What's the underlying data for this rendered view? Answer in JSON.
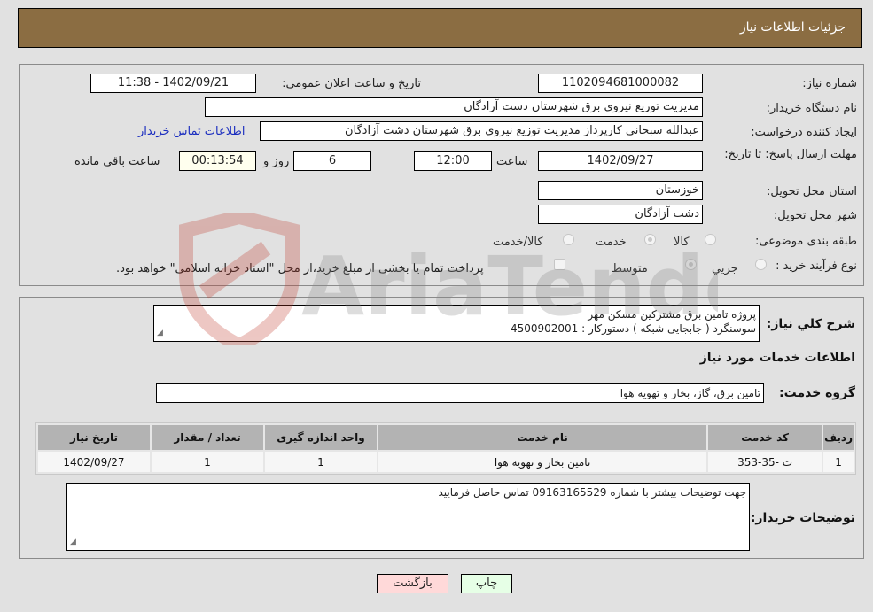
{
  "header": {
    "title": "جزئیات اطلاعات نیاز"
  },
  "details": {
    "need_number_label": "شماره نیاز:",
    "need_number": "1102094681000082",
    "announce_label": "تاریخ و ساعت اعلان عمومی:",
    "announce_value": "1402/09/21 - 11:38",
    "buyer_org_label": "نام دستگاه خریدار:",
    "buyer_org": "مدیریت توزیع نیروی برق شهرستان دشت آزادگان",
    "creator_label": "ایجاد کننده درخواست:",
    "creator": "عبدالله سبحانی کارپرداز مدیریت توزیع نیروی برق شهرستان دشت آزادگان",
    "buyer_contact_link": "اطلاعات تماس خریدار",
    "deadline_label": "مهلت ارسال پاسخ: تا تاریخ:",
    "deadline_date": "1402/09/27",
    "time_label": "ساعت",
    "deadline_time": "12:00",
    "days_value": "6",
    "days_label": "روز و",
    "remaining_time": "00:13:54",
    "remaining_label": "ساعت باقي مانده",
    "province_label": "استان محل تحویل:",
    "province": "خوزستان",
    "city_label": "شهر محل تحویل:",
    "city": "دشت آزادگان",
    "category_label": "طبقه بندی موضوعی:",
    "category_options": [
      {
        "label": "کالا",
        "checked": false
      },
      {
        "label": "خدمت",
        "checked": true
      },
      {
        "label": "کالا/خدمت",
        "checked": false
      }
    ],
    "process_label": "نوع فرآیند خرید :",
    "process_options": [
      {
        "label": "جزيي",
        "checked": false
      },
      {
        "label": "متوسط",
        "checked": true
      }
    ],
    "treasury_note": "پرداخت تمام یا بخشی از مبلغ خرید،از محل \"اسناد خزانه اسلامی\" خواهد بود."
  },
  "description": {
    "label": "شرح کلي نياز:",
    "line1": "پروژه تامین برق مشترکین مسکن مهر",
    "line2": "سوسنگرد ( جابجایی شبکه )  دستورکار : 4500902001"
  },
  "services": {
    "section_title": "اطلاعات خدمات مورد نياز",
    "group_label": "گروه خدمت:",
    "group_value": "تامین برق، گاز، بخار و تهویه هوا",
    "table": {
      "headers": [
        "ردیف",
        "کد خدمت",
        "نام خدمت",
        "واحد اندازه گیری",
        "تعداد / مقدار",
        "تاریخ نیاز"
      ],
      "rows": [
        [
          "1",
          "ت -35-353",
          "تامین بخار و تهویه هوا",
          "1",
          "1",
          "1402/09/27"
        ]
      ]
    }
  },
  "buyer_notes": {
    "label": "توضیحات خریدار:",
    "text": "جهت توضیحات بیشتر با شماره 09163165529 تماس حاصل فرمایید"
  },
  "buttons": {
    "print": "چاپ",
    "back": "بازگشت"
  },
  "watermark": {
    "text": "AriaTender.neT"
  }
}
